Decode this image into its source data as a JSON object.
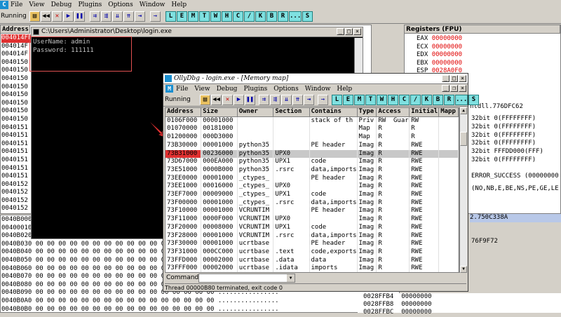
{
  "main": {
    "status": "Running",
    "menu": [
      "File",
      "View",
      "Debug",
      "Plugins",
      "Options",
      "Window",
      "Help"
    ],
    "letters": [
      "L",
      "E",
      "M",
      "T",
      "W",
      "H",
      "C",
      "/",
      "K",
      "B",
      "R",
      "...",
      "S"
    ],
    "address_header": "Address",
    "top_addresses": [
      "004014FF",
      "004014F",
      "004014F",
      "0040150",
      "0040150",
      "0040150",
      "0040150",
      "0040150",
      "0040150",
      "0040150",
      "0040150",
      "0040151",
      "0040151",
      "0040151",
      "0040151",
      "0040151",
      "0040151",
      "0040151",
      "0040152",
      "0040152",
      "0040152",
      "0040152"
    ],
    "dump_rows": [
      "0040B000",
      "00400010",
      "0040B020",
      "0040B030",
      "0040B040",
      "0040B050",
      "0040B060",
      "0040B070",
      "0040B080",
      "0040B090",
      "0040B0A0",
      "0040B0B0"
    ],
    "dump_bytes": "00 00 00 00 00 00 00 00 00 00 00 00 00 00 00 00",
    "dump_ascii": "................"
  },
  "registers": {
    "title": "Registers (FPU)",
    "regs": [
      {
        "name": "EAX",
        "value": "00000000"
      },
      {
        "name": "ECX",
        "value": "00000000"
      },
      {
        "name": "EDX",
        "value": "00000000"
      },
      {
        "name": "EBX",
        "value": "00000000"
      },
      {
        "name": "ESP",
        "value": "0028A0F0"
      }
    ],
    "partial": [
      "ntdll.776DFC62",
      "32bit 0(FFFFFFFF)",
      "32bit 0(FFFFFFFF)",
      "32bit 0(FFFFFFFF)",
      "32bit 0(FFFFFFFF)",
      "32bit FFFDD000(FFF)",
      "32bit 0(FFFFFFFF)",
      "ERROR_SUCCESS (00000000",
      "(NO,NB,E,BE,NS,PE,GE,LE",
      "2.750C338A",
      "76F9F72"
    ],
    "stack_rows": [
      {
        "addr": "0028FFB4",
        "val": "00000000"
      },
      {
        "addr": "0028FFB8",
        "val": "00000000"
      },
      {
        "addr": "0028FFBC",
        "val": "00000000"
      }
    ]
  },
  "console": {
    "title": "C:\\Users\\Administrator\\Desktop\\login.exe",
    "line1": "UserName: admin",
    "line2": "Password: 111111"
  },
  "memmap": {
    "title": "OllyDbg - login.exe - [Memory map]",
    "menu": [
      "File",
      "View",
      "Debug",
      "Plugins",
      "Options",
      "Window",
      "Help"
    ],
    "status": "Running",
    "letters": [
      "L",
      "E",
      "M",
      "T",
      "W",
      "H",
      "C",
      "/",
      "K",
      "B",
      "R",
      "...",
      "S"
    ],
    "columns": [
      "Address",
      "Size",
      "Owner",
      "Section",
      "Contains",
      "Type",
      "Access",
      "Initial",
      "Mapp"
    ],
    "rows": [
      [
        "0106F000",
        "00001000",
        "",
        "",
        "stack of th",
        "Priv",
        "RW  Guar",
        "RW",
        ""
      ],
      [
        "01070000",
        "00181000",
        "",
        "",
        "",
        "Map",
        "R",
        "R",
        ""
      ],
      [
        "01200000",
        "000D3000",
        "",
        "",
        "",
        "Map",
        "R",
        "R",
        ""
      ],
      [
        "73B30000",
        "00001000",
        "python35",
        "",
        "PE header",
        "Imag",
        "R",
        "RWE",
        ""
      ],
      [
        "73B31000",
        "00236000",
        "python35",
        "UPX0",
        "",
        "Imag",
        "R",
        "RWE",
        ""
      ],
      [
        "73D67000",
        "000EA000",
        "python35",
        "UPX1",
        "code",
        "Imag",
        "R",
        "RWE",
        ""
      ],
      [
        "73E51000",
        "0000B000",
        "python35",
        ".rsrc",
        "data,imports",
        "Imag",
        "R",
        "RWE",
        ""
      ],
      [
        "73EE0000",
        "00001000",
        "_ctypes_",
        "",
        "PE header",
        "Imag",
        "R",
        "RWE",
        ""
      ],
      [
        "73EE1000",
        "00016000",
        "_ctypes_",
        "UPX0",
        "",
        "Imag",
        "R",
        "RWE",
        ""
      ],
      [
        "73EF7000",
        "00009000",
        "_ctypes_",
        "UPX1",
        "code",
        "Imag",
        "R",
        "RWE",
        ""
      ],
      [
        "73F00000",
        "00001000",
        "_ctypes_",
        ".rsrc",
        "data,imports",
        "Imag",
        "R",
        "RWE",
        ""
      ],
      [
        "73F10000",
        "00001000",
        "VCRUNTIM",
        "",
        "PE header",
        "Imag",
        "R",
        "RWE",
        ""
      ],
      [
        "73F11000",
        "0000F000",
        "VCRUNTIM",
        "UPX0",
        "",
        "Imag",
        "R",
        "RWE",
        ""
      ],
      [
        "73F20000",
        "00008000",
        "VCRUNTIM",
        "UPX1",
        "code",
        "Imag",
        "R",
        "RWE",
        ""
      ],
      [
        "73F28000",
        "00001000",
        "VCRUNTIM",
        ".rsrc",
        "data,imports",
        "Imag",
        "R",
        "RWE",
        ""
      ],
      [
        "73F30000",
        "00001000",
        "ucrtbase",
        "",
        "PE header",
        "Imag",
        "R",
        "RWE",
        ""
      ],
      [
        "73F31000",
        "000CC000",
        "ucrtbase",
        ".text",
        "code,exports",
        "Imag",
        "R",
        "RWE",
        ""
      ],
      [
        "73FFD000",
        "00002000",
        "ucrtbase",
        ".data",
        "data",
        "Imag",
        "R",
        "RWE",
        ""
      ],
      [
        "73FFF000",
        "00002000",
        "ucrtbase",
        ".idata",
        "imports",
        "Imag",
        "R",
        "RWE",
        ""
      ]
    ],
    "selected_row": 4,
    "command_label": "Command",
    "status_bar": "Thread 00000B80 terminated, exit code 0"
  },
  "colors": {
    "accent": "#ff0000",
    "selected_highlight": "#e03030",
    "console_bg": "#000000"
  }
}
